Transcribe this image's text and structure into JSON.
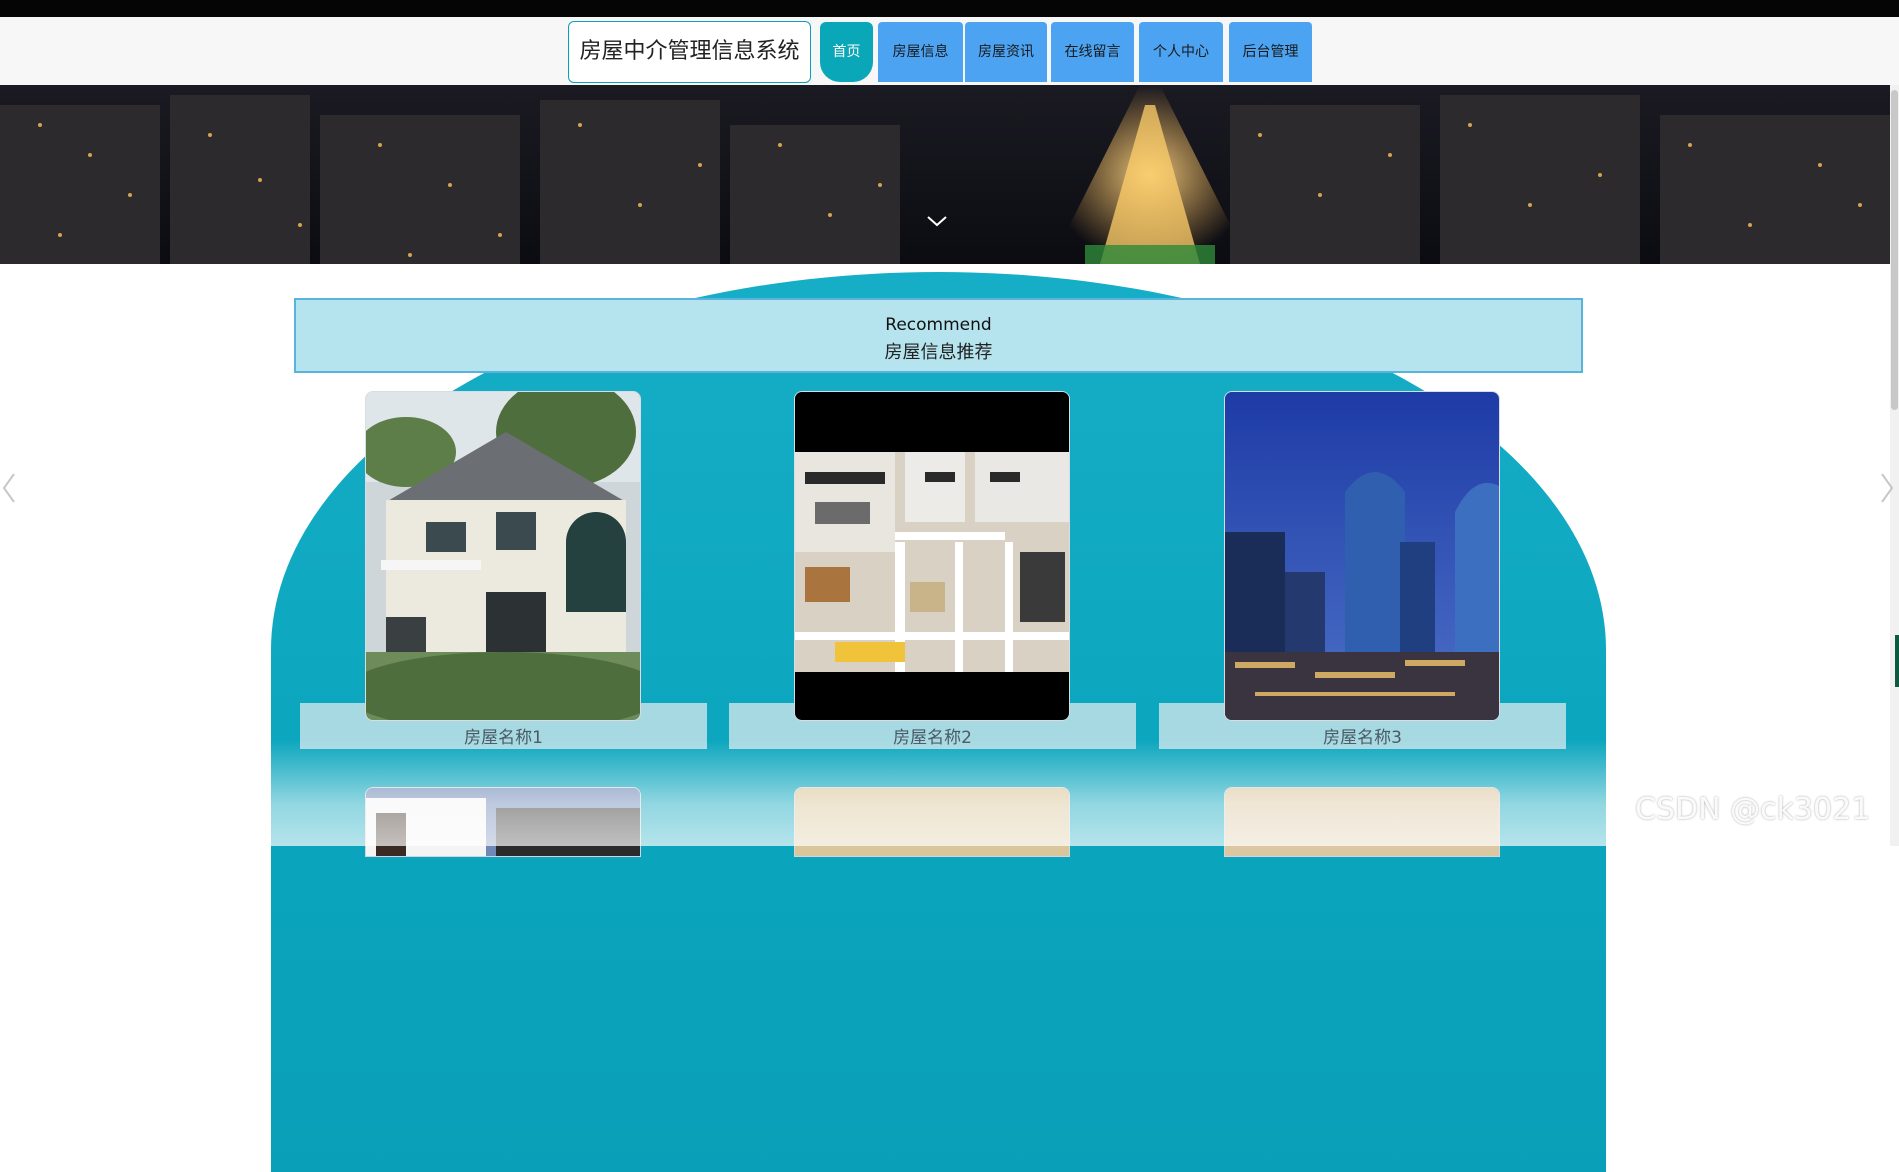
{
  "header": {
    "brand": "房屋中介管理信息系统",
    "nav": [
      "首页",
      "房屋信息",
      "房屋资讯",
      "在线留言",
      "个人中心",
      "后台管理"
    ],
    "active_index": 0
  },
  "recommend": {
    "title_en": "Recommend",
    "title_cn": "房屋信息推荐",
    "items": [
      {
        "name": "房屋名称1"
      },
      {
        "name": "房屋名称2"
      },
      {
        "name": "房屋名称3"
      }
    ]
  },
  "watermark": "CSDN @ck3021",
  "colors": {
    "accent": "#0aa7b9",
    "nav_button": "#4ba3f2",
    "dome": "#0aa5bd",
    "recommend_bg": "#b6e4ee"
  },
  "icons": {
    "banner_scroll": "chevron-down-icon",
    "carousel_prev": "chevron-left-icon",
    "carousel_next": "chevron-right-icon"
  }
}
